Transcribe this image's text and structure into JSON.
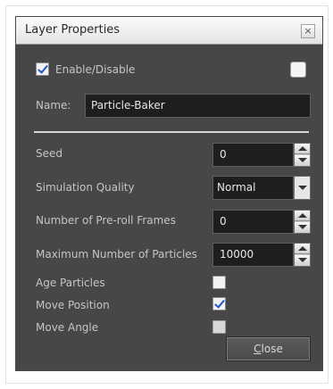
{
  "window": {
    "title": "Layer Properties",
    "close_glyph": "×"
  },
  "enable": {
    "label": "Enable/Disable",
    "checked": true
  },
  "name": {
    "label": "Name:",
    "value": "Particle-Baker"
  },
  "fields": {
    "seed": {
      "label": "Seed",
      "value": "0"
    },
    "simulation_quality": {
      "label": "Simulation Quality",
      "value": "Normal"
    },
    "preroll_frames": {
      "label": "Number of Pre-roll Frames",
      "value": "0"
    },
    "max_particles": {
      "label": "Maximum Number of Particles",
      "value": "10000"
    }
  },
  "options": {
    "age_particles": {
      "label": "Age Particles",
      "checked": false
    },
    "move_position": {
      "label": "Move Position",
      "checked": true
    },
    "move_angle": {
      "label": "Move Angle",
      "checked": false
    }
  },
  "buttons": {
    "close_mnemonic": "C",
    "close_rest": "lose"
  },
  "colors": {
    "panel": "#474747",
    "field_bg": "#1e1e1e",
    "check_blue": "#1d58c8"
  }
}
